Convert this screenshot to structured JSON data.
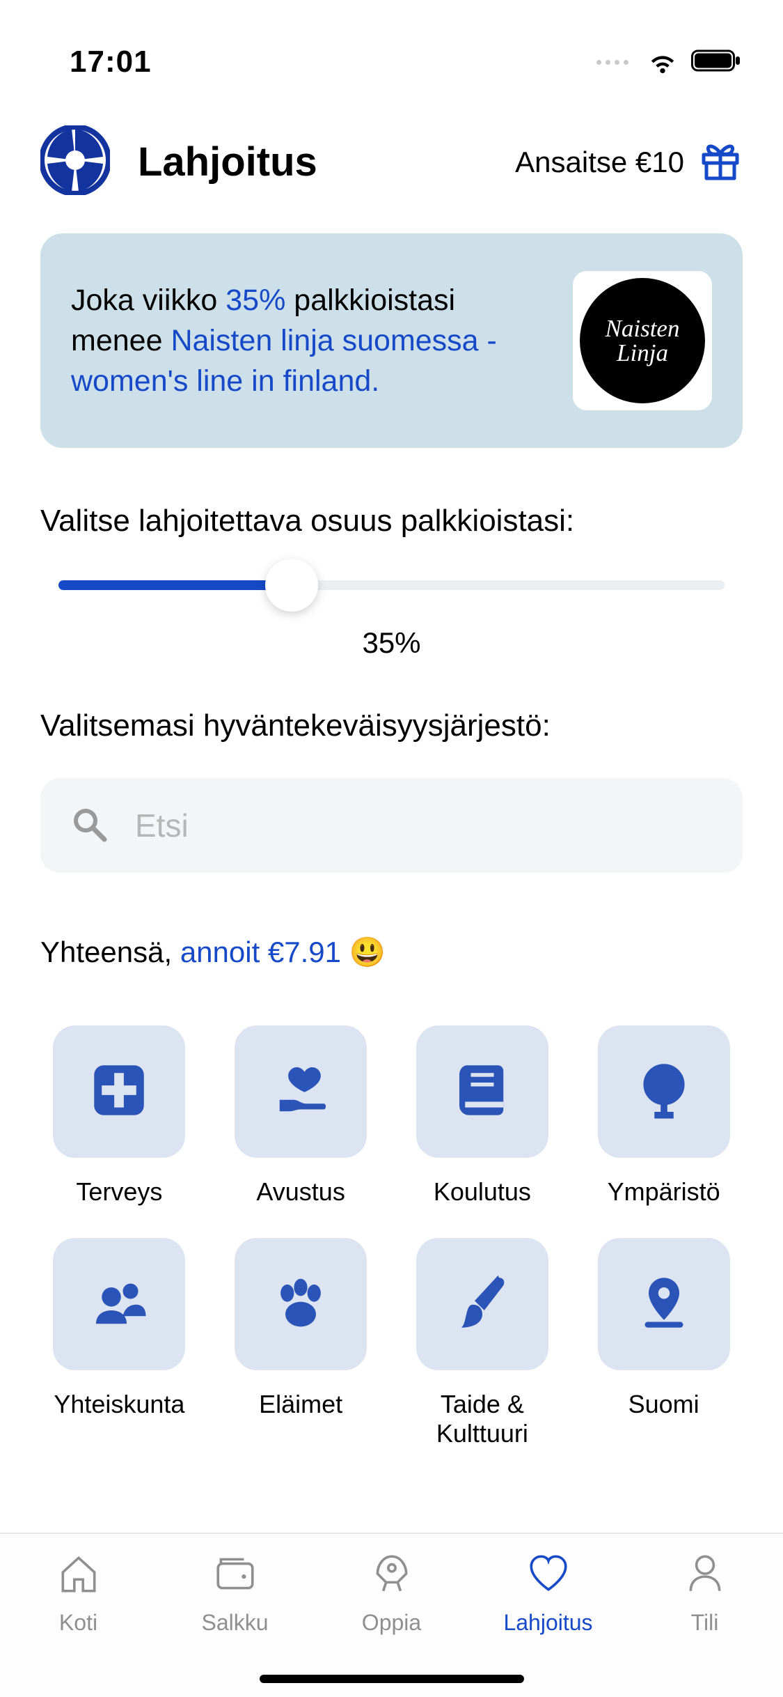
{
  "status": {
    "time": "17:01"
  },
  "header": {
    "title": "Lahjoitus",
    "earn_label": "Ansaitse €10"
  },
  "banner": {
    "text_prefix": "Joka viikko ",
    "percent": "35%",
    "text_mid": " palkkioistasi menee ",
    "charity": "Naisten linja suomessa - women's line in finland.",
    "logo_text": "Naisten Linja"
  },
  "slider": {
    "label": "Valitse lahjoitettava osuus palkkioistasi:",
    "value_label": "35%",
    "value_pct": 35
  },
  "charity_section": {
    "label": "Valitsemasi hyväntekeväisyysjärjestö:",
    "search_placeholder": "Etsi"
  },
  "total": {
    "prefix": "Yhteensä, ",
    "highlight": "annoit €7.91",
    "emoji": "😃"
  },
  "categories": [
    {
      "id": "health",
      "label": "Terveys"
    },
    {
      "id": "aid",
      "label": "Avustus"
    },
    {
      "id": "education",
      "label": "Koulutus"
    },
    {
      "id": "environment",
      "label": "Ympäristö"
    },
    {
      "id": "society",
      "label": "Yhteiskunta"
    },
    {
      "id": "animals",
      "label": "Eläimet"
    },
    {
      "id": "arts",
      "label": "Taide & Kulttuuri"
    },
    {
      "id": "finland",
      "label": "Suomi"
    }
  ],
  "tabs": [
    {
      "id": "home",
      "label": "Koti"
    },
    {
      "id": "wallet",
      "label": "Salkku"
    },
    {
      "id": "learn",
      "label": "Oppia"
    },
    {
      "id": "donate",
      "label": "Lahjoitus",
      "active": true
    },
    {
      "id": "account",
      "label": "Tili"
    }
  ]
}
